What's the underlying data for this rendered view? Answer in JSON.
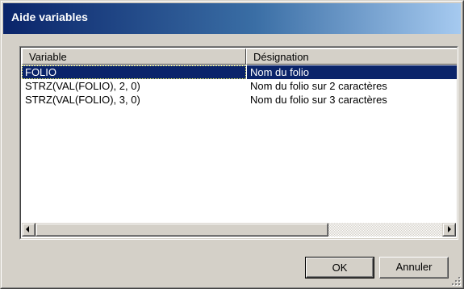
{
  "window": {
    "title": "Aide variables"
  },
  "list": {
    "columns": [
      "Variable",
      "Désignation"
    ],
    "rows": [
      {
        "variable": "FOLIO",
        "designation": "Nom du folio",
        "selected": true
      },
      {
        "variable": "STRZ(VAL(FOLIO), 2, 0)",
        "designation": "Nom du folio sur 2 caractères",
        "selected": false
      },
      {
        "variable": "STRZ(VAL(FOLIO), 3, 0)",
        "designation": "Nom du folio sur 3 caractères",
        "selected": false
      }
    ]
  },
  "buttons": {
    "ok": "OK",
    "cancel": "Annuler"
  },
  "icons": {
    "scroll_left": "arrow-left-icon",
    "scroll_right": "arrow-right-icon",
    "resize": "resize-grip-icon"
  },
  "colors": {
    "title_start": "#0a246a",
    "title_end": "#a6caf0",
    "selection": "#0a246a",
    "face": "#d4d0c8"
  }
}
